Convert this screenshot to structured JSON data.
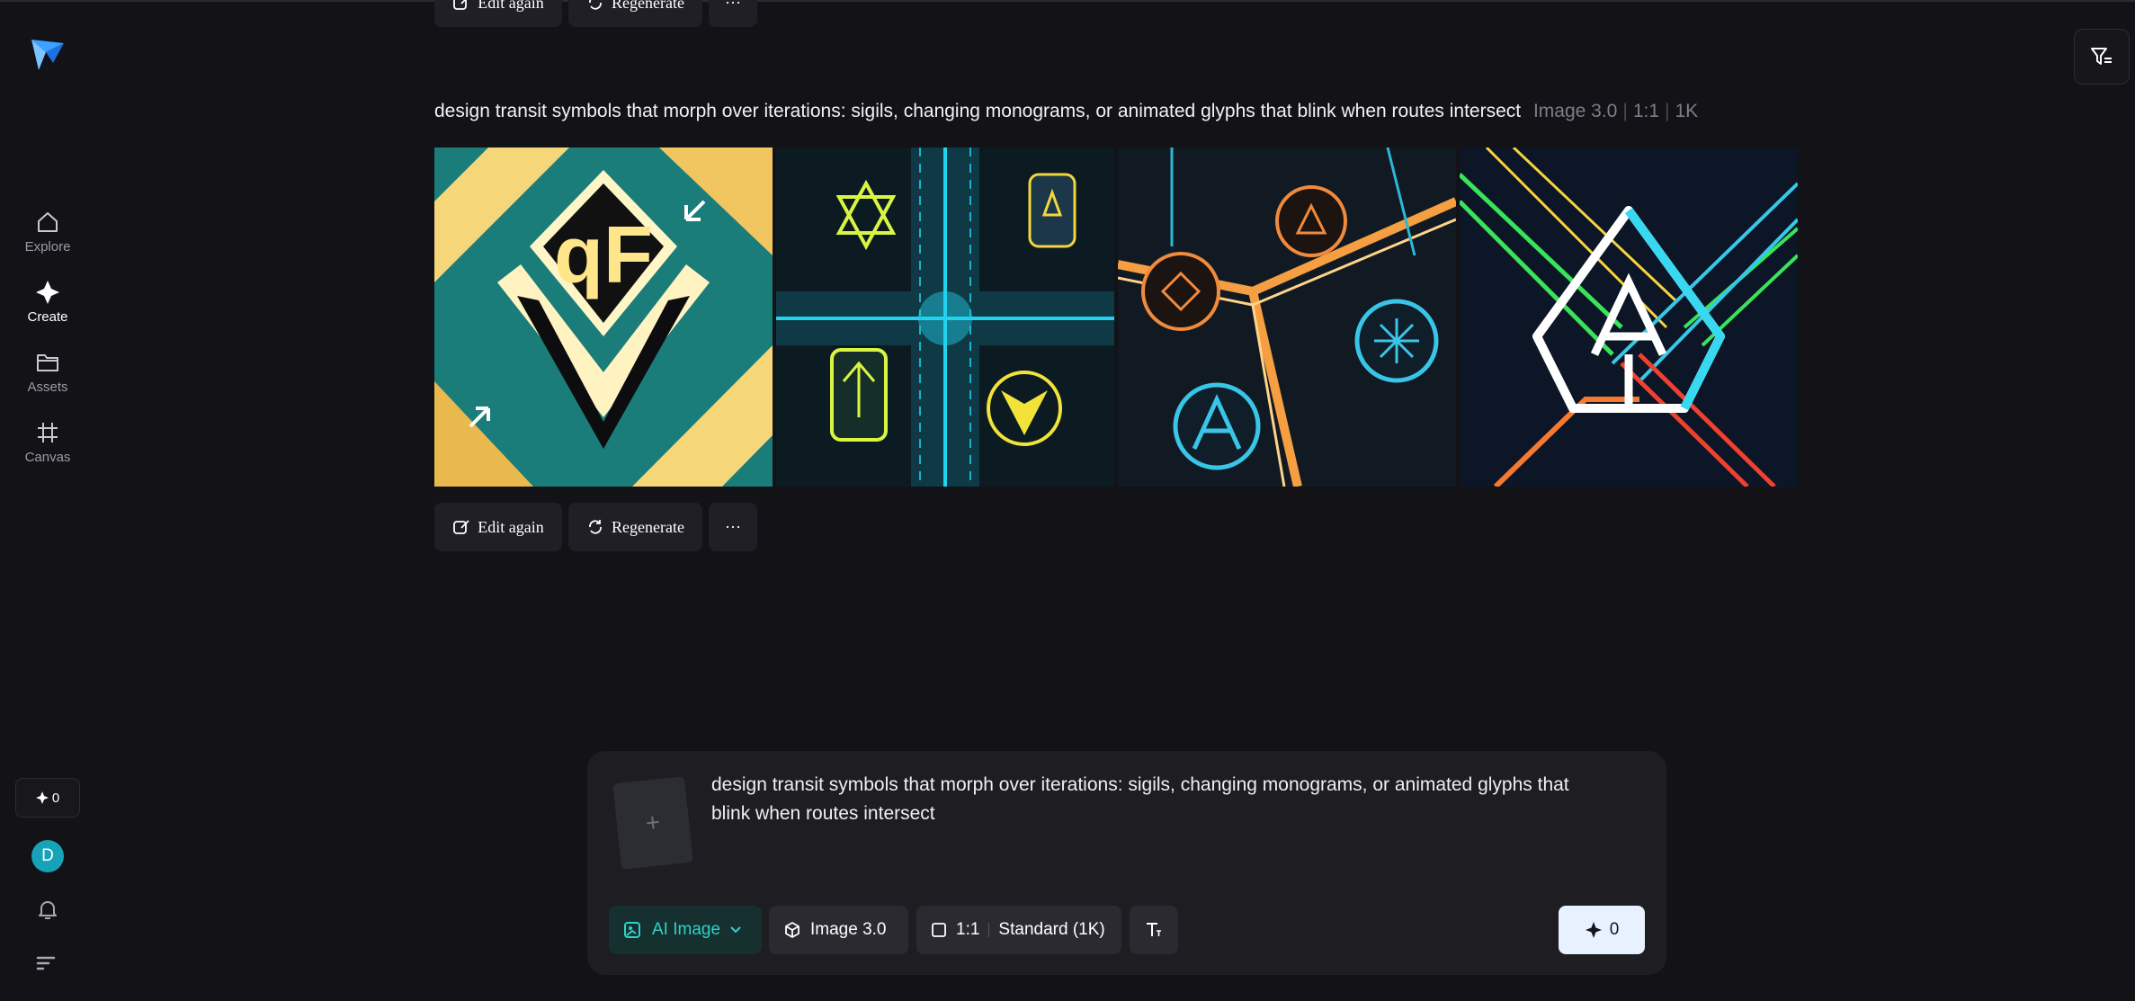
{
  "sidebar": {
    "items": [
      {
        "label": "Explore"
      },
      {
        "label": "Create"
      },
      {
        "label": "Assets"
      },
      {
        "label": "Canvas"
      }
    ],
    "credits": "0",
    "avatar_letter": "D"
  },
  "previous_generation": {
    "edit_label": "Edit again",
    "regenerate_label": "Regenerate",
    "more_label": "···"
  },
  "generation": {
    "prompt": "design transit symbols that morph over iterations: sigils, changing monograms, or animated glyphs that blink when routes intersect",
    "model": "Image 3.0",
    "ratio": "1:1",
    "resolution": "1K",
    "edit_label": "Edit again",
    "regenerate_label": "Regenerate",
    "more_label": "···"
  },
  "composer": {
    "add_icon": "+",
    "text": "design transit symbols that morph over iterations: sigils, changing monograms, or animated glyphs that blink when routes intersect",
    "mode_label": "AI Image",
    "model_label": "Image 3.0",
    "ratio_label": "1:1",
    "quality_label": "Standard (1K)",
    "send_count": "0"
  },
  "colors": {
    "background": "#121217",
    "accent": "#2ad4c8",
    "send_button": "#e8f1ff"
  }
}
